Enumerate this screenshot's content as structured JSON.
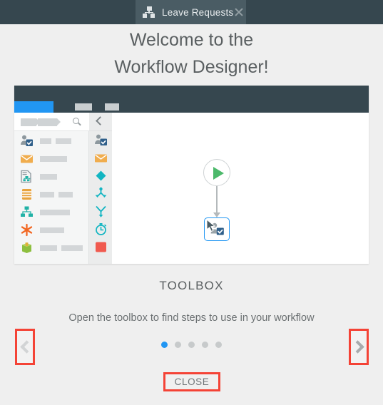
{
  "window": {
    "tab": {
      "label": "Leave Requests",
      "icon": "sitemap-icon",
      "close_icon": "close-icon"
    }
  },
  "headline": {
    "line1": "Welcome to the",
    "line2": "Workflow Designer!"
  },
  "illustration": {
    "topbar": {
      "active_tab_color": "#2196f3",
      "background": "#36474f",
      "placeholder_count": 2
    },
    "search": {
      "icon": "search-icon",
      "breadcrumb_placeholders": 2
    },
    "toolbox_items": [
      {
        "icon": "user-task-icon",
        "bars": [
          16,
          22
        ]
      },
      {
        "icon": "envelope-icon",
        "bars": [
          38
        ]
      },
      {
        "icon": "document-flow-icon",
        "bars": [
          24
        ]
      },
      {
        "icon": "database-icon",
        "bars": [
          20,
          20
        ]
      },
      {
        "icon": "org-chart-icon",
        "bars": [
          42
        ]
      },
      {
        "icon": "asterisk-icon",
        "bars": [
          34
        ]
      },
      {
        "icon": "package-icon",
        "bars": [
          24,
          30
        ]
      }
    ],
    "strip": {
      "back_icon": "chevron-left-icon",
      "items": [
        "user-task-icon",
        "envelope-icon",
        "diamond-decision-icon",
        "split-branch-icon",
        "merge-branch-icon",
        "timer-icon",
        "stop-icon"
      ]
    },
    "canvas": {
      "start_node": {
        "icon": "play-icon",
        "color": "#4cb96b"
      },
      "selected_node": {
        "icon": "user-task-icon",
        "selection_color": "#2196f3"
      },
      "cursor": "mouse-pointer-icon",
      "connector": "arrow-down-connector"
    }
  },
  "caption": {
    "title": "TOOLBOX",
    "subtitle": "Open the toolbox to find steps to use in your workflow"
  },
  "pagination": {
    "total": 5,
    "active_index": 0
  },
  "nav": {
    "prev_label": "chevron-left-icon",
    "next_label": "chevron-right-icon",
    "prev_enabled": false,
    "next_enabled": true,
    "highlight_color": "#f44336"
  },
  "close": {
    "label": "CLOSE"
  }
}
